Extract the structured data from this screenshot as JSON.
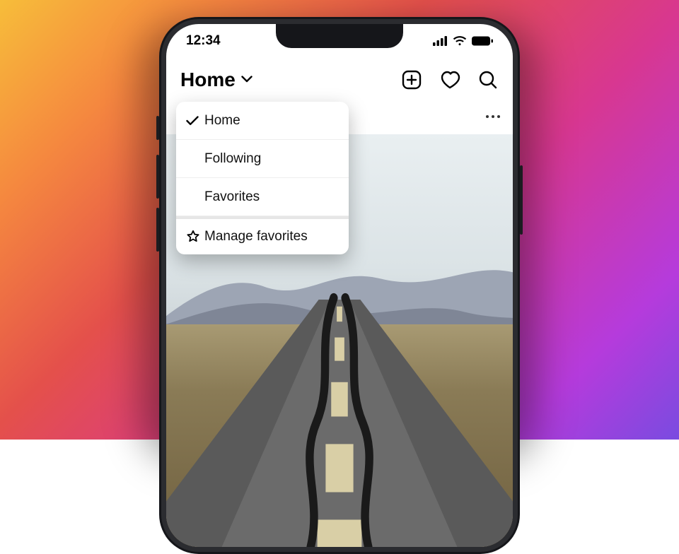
{
  "status": {
    "time": "12:34"
  },
  "header": {
    "title": "Home"
  },
  "menu": {
    "items": [
      {
        "label": "Home",
        "selected": true
      },
      {
        "label": "Following",
        "selected": false
      },
      {
        "label": "Favorites",
        "selected": false
      }
    ],
    "manage_label": "Manage favorites"
  }
}
